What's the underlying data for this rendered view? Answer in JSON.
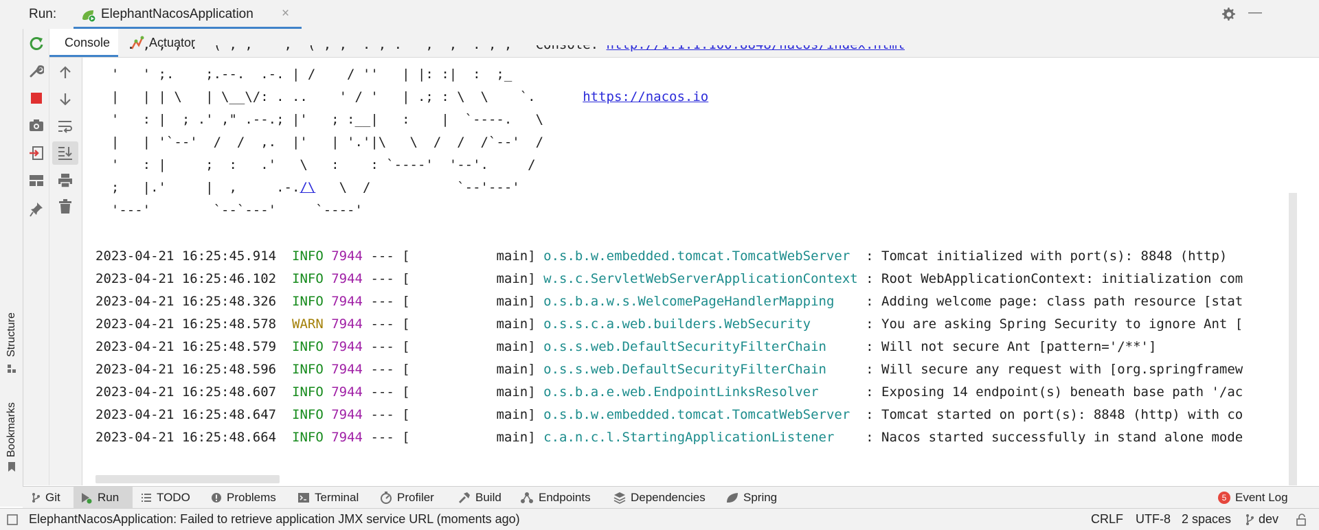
{
  "run_bar": {
    "label": "Run:",
    "config_tab": "ElephantNacosApplication",
    "close_symbol": "×",
    "minimize_symbol": "—",
    "icons": [
      "spring-boot-run-icon",
      "gear-icon",
      "minimize-icon"
    ]
  },
  "sub_tabs": {
    "console": "Console",
    "actuator": "Actuator"
  },
  "left_toolbar": [
    "rerun-icon",
    "wrench-icon",
    "stop-icon",
    "camera-icon",
    "login-icon",
    "layout-icon",
    "pin-icon"
  ],
  "console_toolbar": [
    "arrow-up-icon",
    "arrow-down-icon",
    "soft-wrap-icon",
    "scroll-to-end-icon",
    "print-icon",
    "trash-icon"
  ],
  "side_labels": {
    "structure": "Structure",
    "bookmarks": "Bookmarks"
  },
  "console": {
    "ascii_art": [
      "  '   ' ;.    ;.--.  .-. | /    / ''   | |: :|  :  ;_",
      "  |   | | \\   | \\__\\/: . ..    ' / '   | .; : \\  \\    `.      ",
      "  '   : |  ; .' ,\" .--.; |'   ; :__|   :    |  `----.   \\",
      "  |   | '`--'  /  /  ,.  |'   | '.'|\\   \\  /  /  /`--'  /",
      "  '   : |     ;  :   .'   \\   :    : `----'  '--'.     /",
      "  ;   |.'     |  ,     .-.",
      "  '---'        `--`---'     `----'"
    ],
    "ascii_tail_7": "   \\  /           `--'---'",
    "link_nacos": "https://nacos.io",
    "link_slash": "/\\",
    "logs": [
      {
        "ts": "2023-04-21 16:25:45.914",
        "level": "INFO",
        "pid": "7944",
        "sep": "---",
        "thread": "[           main]",
        "logger": "o.s.b.w.embedded.tomcat.TomcatWebServer ",
        "msg": " : Tomcat initialized with port(s): 8848 (http)"
      },
      {
        "ts": "2023-04-21 16:25:46.102",
        "level": "INFO",
        "pid": "7944",
        "sep": "---",
        "thread": "[           main]",
        "logger": "w.s.c.ServletWebServerApplicationContext",
        "msg": " : Root WebApplicationContext: initialization com"
      },
      {
        "ts": "2023-04-21 16:25:48.326",
        "level": "INFO",
        "pid": "7944",
        "sep": "---",
        "thread": "[           main]",
        "logger": "o.s.b.a.w.s.WelcomePageHandlerMapping   ",
        "msg": " : Adding welcome page: class path resource [stat"
      },
      {
        "ts": "2023-04-21 16:25:48.578",
        "level": "WARN",
        "pid": "7944",
        "sep": "---",
        "thread": "[           main]",
        "logger": "o.s.s.c.a.web.builders.WebSecurity      ",
        "msg": " : You are asking Spring Security to ignore Ant ["
      },
      {
        "ts": "2023-04-21 16:25:48.579",
        "level": "INFO",
        "pid": "7944",
        "sep": "---",
        "thread": "[           main]",
        "logger": "o.s.s.web.DefaultSecurityFilterChain    ",
        "msg": " : Will not secure Ant [pattern='/**']"
      },
      {
        "ts": "2023-04-21 16:25:48.596",
        "level": "INFO",
        "pid": "7944",
        "sep": "---",
        "thread": "[           main]",
        "logger": "o.s.s.web.DefaultSecurityFilterChain    ",
        "msg": " : Will secure any request with [org.springframew"
      },
      {
        "ts": "2023-04-21 16:25:48.607",
        "level": "INFO",
        "pid": "7944",
        "sep": "---",
        "thread": "[           main]",
        "logger": "o.s.b.a.e.web.EndpointLinksResolver     ",
        "msg": " : Exposing 14 endpoint(s) beneath base path '/ac"
      },
      {
        "ts": "2023-04-21 16:25:48.647",
        "level": "INFO",
        "pid": "7944",
        "sep": "---",
        "thread": "[           main]",
        "logger": "o.s.b.w.embedded.tomcat.TomcatWebServer ",
        "msg": " : Tomcat started on port(s): 8848 (http) with co"
      },
      {
        "ts": "2023-04-21 16:25:48.664",
        "level": "INFO",
        "pid": "7944",
        "sep": "---",
        "thread": "[           main]",
        "logger": "c.a.n.c.l.StartingApplicationListener   ",
        "msg": " : Nacos started successfully in stand alone mode"
      }
    ]
  },
  "bottom_tabs": [
    {
      "label": "Git",
      "icon": "git-branch-icon"
    },
    {
      "label": "Run",
      "icon": "run-icon",
      "active": true
    },
    {
      "label": "TODO",
      "icon": "list-icon"
    },
    {
      "label": "Problems",
      "icon": "problems-icon"
    },
    {
      "label": "Terminal",
      "icon": "terminal-icon"
    },
    {
      "label": "Profiler",
      "icon": "profiler-icon"
    },
    {
      "label": "Build",
      "icon": "hammer-icon"
    },
    {
      "label": "Endpoints",
      "icon": "endpoints-icon"
    },
    {
      "label": "Dependencies",
      "icon": "layers-icon"
    },
    {
      "label": "Spring",
      "icon": "spring-leaf-icon"
    }
  ],
  "event_log": {
    "label": "Event Log",
    "badge": "5"
  },
  "status_bar": {
    "message": "ElephantNacosApplication: Failed to retrieve application JMX service URL (moments ago)",
    "line_sep": "CRLF",
    "encoding": "UTF-8",
    "indent": "2 spaces",
    "branch": "dev"
  },
  "colors": {
    "info": "#158a1b",
    "warn": "#a37f06",
    "pid": "#a020a6",
    "logger": "#1c8c8c",
    "link": "#2a2ad9",
    "accent": "#4083c9",
    "stop": "#e03030",
    "badge": "#e5473d"
  }
}
